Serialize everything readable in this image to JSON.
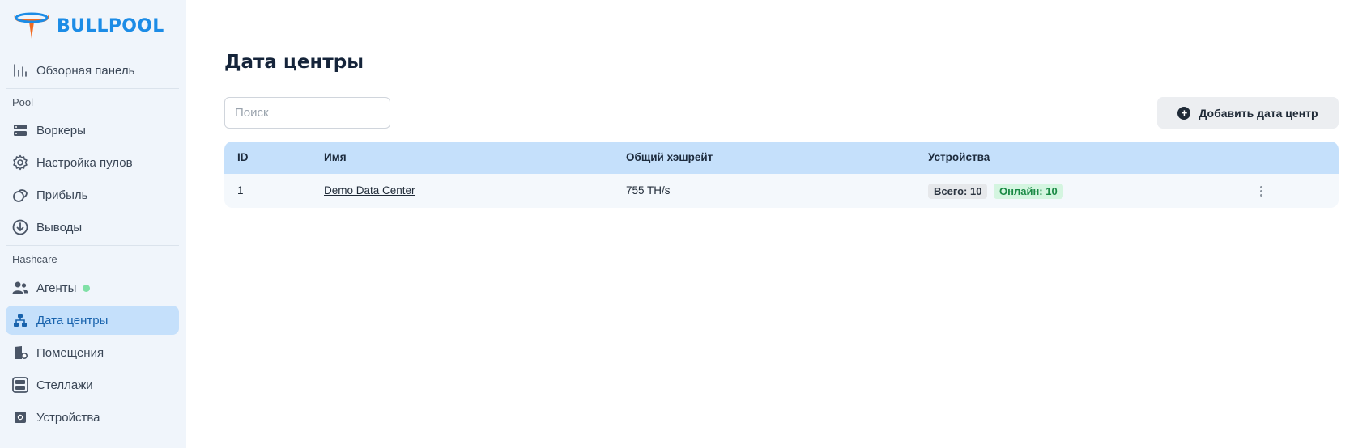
{
  "brand": {
    "name": "BULLPOOL",
    "color": "#1c8ce6",
    "accent": "#f26b21"
  },
  "sidebar": {
    "top_item": {
      "label": "Обзорная панель",
      "icon": "bar-chart-icon"
    },
    "sections": [
      {
        "label": "Pool",
        "items": [
          {
            "label": "Воркеры",
            "icon": "server-icon"
          },
          {
            "label": "Настройка пулов",
            "icon": "gear-icon"
          },
          {
            "label": "Прибыль",
            "icon": "coins-icon"
          },
          {
            "label": "Выводы",
            "icon": "download-circle-icon"
          }
        ]
      },
      {
        "label": "Hashcare",
        "items": [
          {
            "label": "Агенты",
            "icon": "users-icon",
            "status_color": "#7fe0a6"
          },
          {
            "label": "Дата центры",
            "icon": "hierarchy-icon",
            "active": true
          },
          {
            "label": "Помещения",
            "icon": "building-gear-icon"
          },
          {
            "label": "Стеллажи",
            "icon": "rack-icon"
          },
          {
            "label": "Устройства",
            "icon": "chip-icon"
          }
        ]
      }
    ]
  },
  "main": {
    "title": "Дата центры",
    "search": {
      "placeholder": "Поиск",
      "value": ""
    },
    "add_button": {
      "label": "Добавить дата центр",
      "icon": "plus-circle-icon"
    },
    "table": {
      "columns": [
        "ID",
        "Имя",
        "Общий хэшрейт",
        "Устройства"
      ],
      "rows": [
        {
          "id": "1",
          "name": "Demo Data Center",
          "hashrate": "755 TH/s",
          "devices_total": "Всего: 10",
          "devices_online": "Онлайн: 10"
        }
      ]
    }
  },
  "colors": {
    "sidebar_bg": "#f0f5fb",
    "active_bg": "#c5e0fb",
    "table_header_bg": "#c5e0fb",
    "online_badge_bg": "#d4f5e0",
    "online_badge_text": "#1a8a45"
  }
}
